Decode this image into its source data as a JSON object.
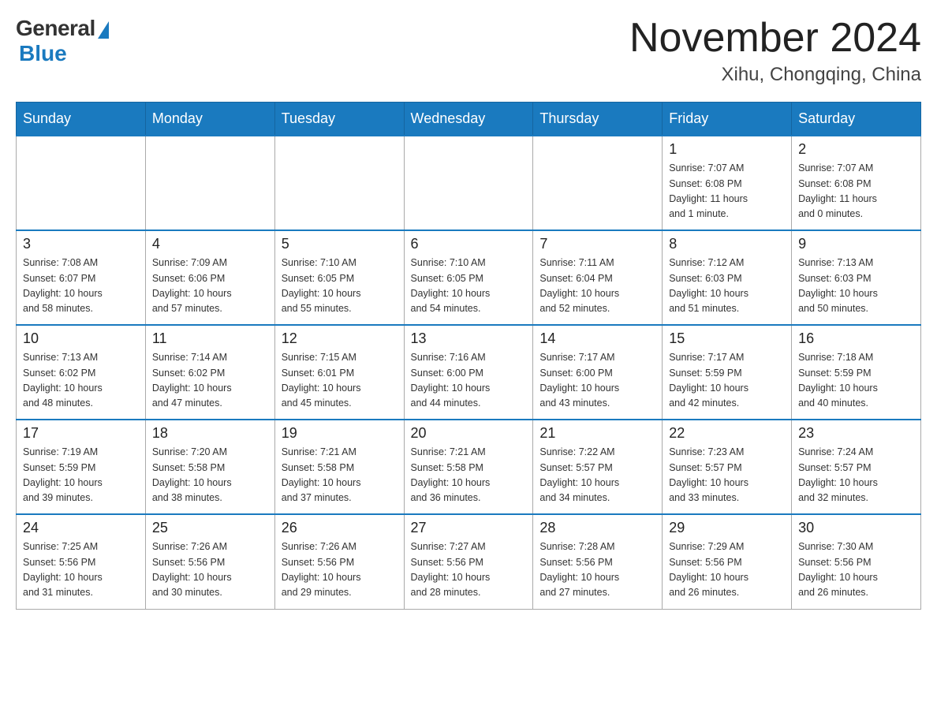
{
  "header": {
    "logo_general": "General",
    "logo_blue": "Blue",
    "month_title": "November 2024",
    "location": "Xihu, Chongqing, China"
  },
  "weekdays": [
    "Sunday",
    "Monday",
    "Tuesday",
    "Wednesday",
    "Thursday",
    "Friday",
    "Saturday"
  ],
  "weeks": [
    [
      {
        "day": "",
        "info": ""
      },
      {
        "day": "",
        "info": ""
      },
      {
        "day": "",
        "info": ""
      },
      {
        "day": "",
        "info": ""
      },
      {
        "day": "",
        "info": ""
      },
      {
        "day": "1",
        "info": "Sunrise: 7:07 AM\nSunset: 6:08 PM\nDaylight: 11 hours\nand 1 minute."
      },
      {
        "day": "2",
        "info": "Sunrise: 7:07 AM\nSunset: 6:08 PM\nDaylight: 11 hours\nand 0 minutes."
      }
    ],
    [
      {
        "day": "3",
        "info": "Sunrise: 7:08 AM\nSunset: 6:07 PM\nDaylight: 10 hours\nand 58 minutes."
      },
      {
        "day": "4",
        "info": "Sunrise: 7:09 AM\nSunset: 6:06 PM\nDaylight: 10 hours\nand 57 minutes."
      },
      {
        "day": "5",
        "info": "Sunrise: 7:10 AM\nSunset: 6:05 PM\nDaylight: 10 hours\nand 55 minutes."
      },
      {
        "day": "6",
        "info": "Sunrise: 7:10 AM\nSunset: 6:05 PM\nDaylight: 10 hours\nand 54 minutes."
      },
      {
        "day": "7",
        "info": "Sunrise: 7:11 AM\nSunset: 6:04 PM\nDaylight: 10 hours\nand 52 minutes."
      },
      {
        "day": "8",
        "info": "Sunrise: 7:12 AM\nSunset: 6:03 PM\nDaylight: 10 hours\nand 51 minutes."
      },
      {
        "day": "9",
        "info": "Sunrise: 7:13 AM\nSunset: 6:03 PM\nDaylight: 10 hours\nand 50 minutes."
      }
    ],
    [
      {
        "day": "10",
        "info": "Sunrise: 7:13 AM\nSunset: 6:02 PM\nDaylight: 10 hours\nand 48 minutes."
      },
      {
        "day": "11",
        "info": "Sunrise: 7:14 AM\nSunset: 6:02 PM\nDaylight: 10 hours\nand 47 minutes."
      },
      {
        "day": "12",
        "info": "Sunrise: 7:15 AM\nSunset: 6:01 PM\nDaylight: 10 hours\nand 45 minutes."
      },
      {
        "day": "13",
        "info": "Sunrise: 7:16 AM\nSunset: 6:00 PM\nDaylight: 10 hours\nand 44 minutes."
      },
      {
        "day": "14",
        "info": "Sunrise: 7:17 AM\nSunset: 6:00 PM\nDaylight: 10 hours\nand 43 minutes."
      },
      {
        "day": "15",
        "info": "Sunrise: 7:17 AM\nSunset: 5:59 PM\nDaylight: 10 hours\nand 42 minutes."
      },
      {
        "day": "16",
        "info": "Sunrise: 7:18 AM\nSunset: 5:59 PM\nDaylight: 10 hours\nand 40 minutes."
      }
    ],
    [
      {
        "day": "17",
        "info": "Sunrise: 7:19 AM\nSunset: 5:59 PM\nDaylight: 10 hours\nand 39 minutes."
      },
      {
        "day": "18",
        "info": "Sunrise: 7:20 AM\nSunset: 5:58 PM\nDaylight: 10 hours\nand 38 minutes."
      },
      {
        "day": "19",
        "info": "Sunrise: 7:21 AM\nSunset: 5:58 PM\nDaylight: 10 hours\nand 37 minutes."
      },
      {
        "day": "20",
        "info": "Sunrise: 7:21 AM\nSunset: 5:58 PM\nDaylight: 10 hours\nand 36 minutes."
      },
      {
        "day": "21",
        "info": "Sunrise: 7:22 AM\nSunset: 5:57 PM\nDaylight: 10 hours\nand 34 minutes."
      },
      {
        "day": "22",
        "info": "Sunrise: 7:23 AM\nSunset: 5:57 PM\nDaylight: 10 hours\nand 33 minutes."
      },
      {
        "day": "23",
        "info": "Sunrise: 7:24 AM\nSunset: 5:57 PM\nDaylight: 10 hours\nand 32 minutes."
      }
    ],
    [
      {
        "day": "24",
        "info": "Sunrise: 7:25 AM\nSunset: 5:56 PM\nDaylight: 10 hours\nand 31 minutes."
      },
      {
        "day": "25",
        "info": "Sunrise: 7:26 AM\nSunset: 5:56 PM\nDaylight: 10 hours\nand 30 minutes."
      },
      {
        "day": "26",
        "info": "Sunrise: 7:26 AM\nSunset: 5:56 PM\nDaylight: 10 hours\nand 29 minutes."
      },
      {
        "day": "27",
        "info": "Sunrise: 7:27 AM\nSunset: 5:56 PM\nDaylight: 10 hours\nand 28 minutes."
      },
      {
        "day": "28",
        "info": "Sunrise: 7:28 AM\nSunset: 5:56 PM\nDaylight: 10 hours\nand 27 minutes."
      },
      {
        "day": "29",
        "info": "Sunrise: 7:29 AM\nSunset: 5:56 PM\nDaylight: 10 hours\nand 26 minutes."
      },
      {
        "day": "30",
        "info": "Sunrise: 7:30 AM\nSunset: 5:56 PM\nDaylight: 10 hours\nand 26 minutes."
      }
    ]
  ]
}
